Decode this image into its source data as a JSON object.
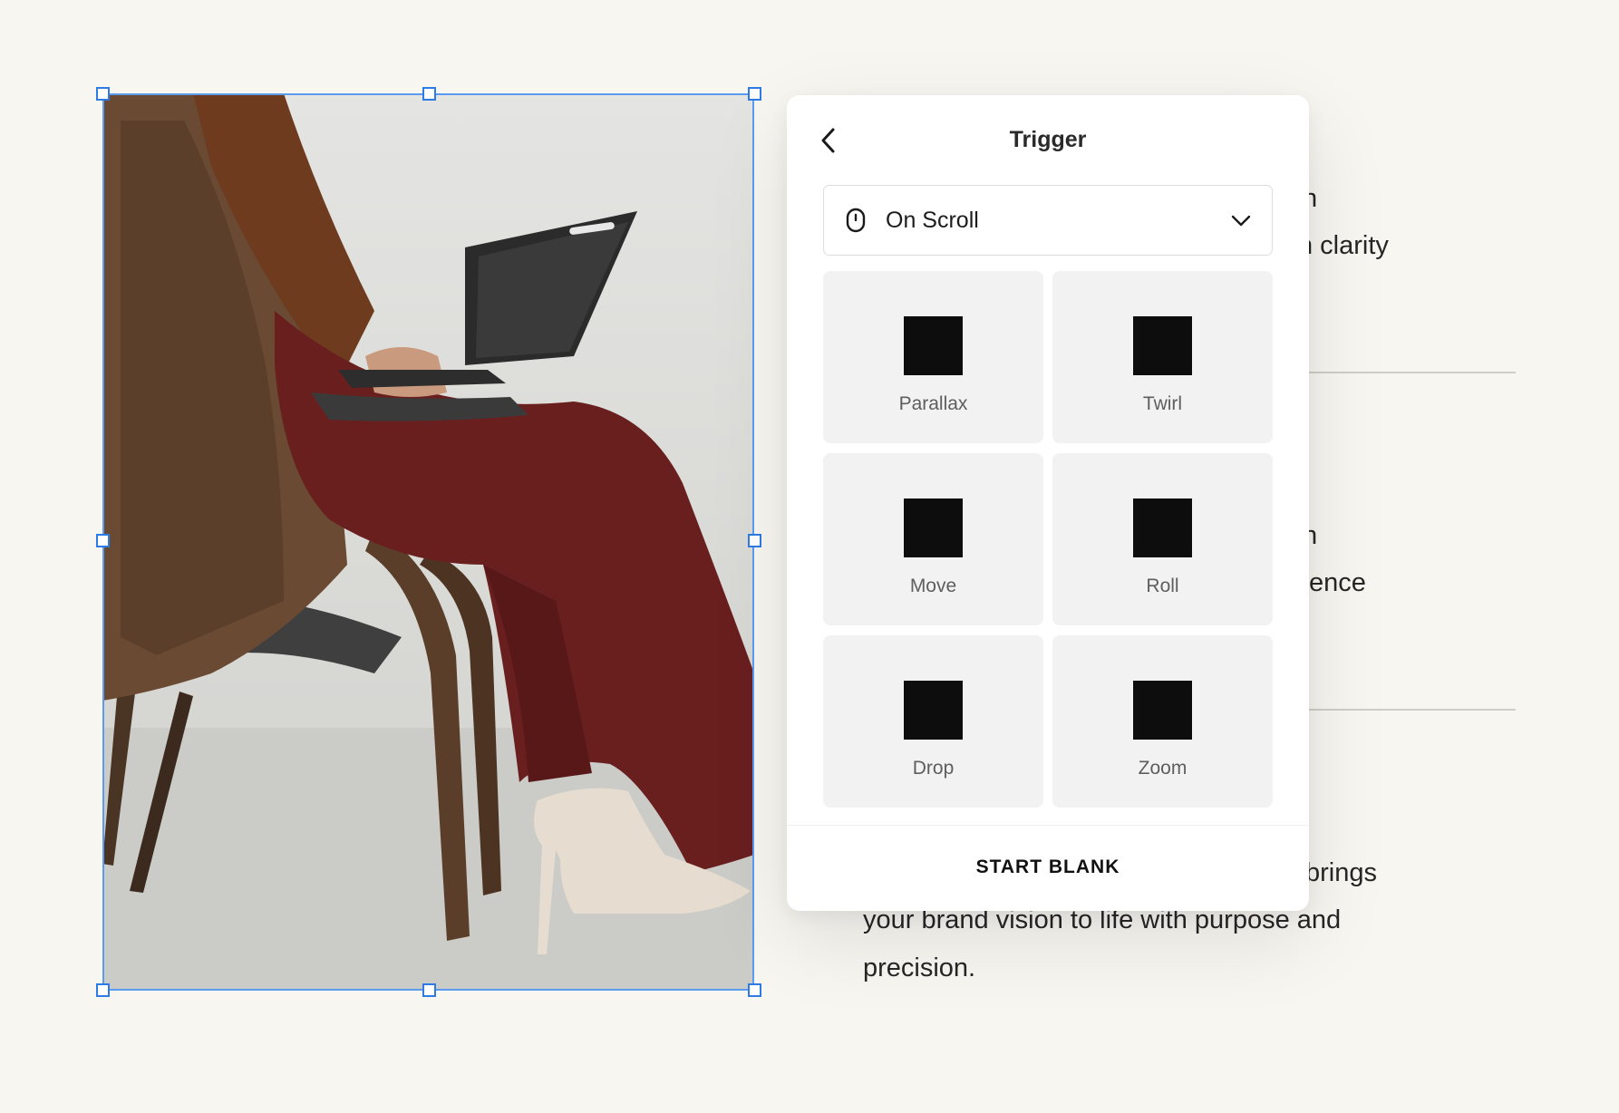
{
  "background_text": {
    "fragment_1": "n",
    "fragment_2": "n clarity",
    "fragment_3": "n",
    "fragment_4": "ence",
    "paragraph_line_1": "brings",
    "paragraph_line_2": "your brand vision to life with purpose and",
    "paragraph_line_3": "precision."
  },
  "panel": {
    "title": "Trigger",
    "trigger_select": {
      "value": "On Scroll",
      "icon": "mouse-icon"
    },
    "effects": [
      {
        "label": "Parallax"
      },
      {
        "label": "Twirl"
      },
      {
        "label": "Move"
      },
      {
        "label": "Roll"
      },
      {
        "label": "Drop"
      },
      {
        "label": "Zoom"
      }
    ],
    "start_blank_label": "START BLANK"
  },
  "colors": {
    "page_background": "#f7f6f1",
    "selection_accent": "#2f7be6",
    "tile_background": "#f2f2f2",
    "swatch": "#0d0d0d"
  }
}
